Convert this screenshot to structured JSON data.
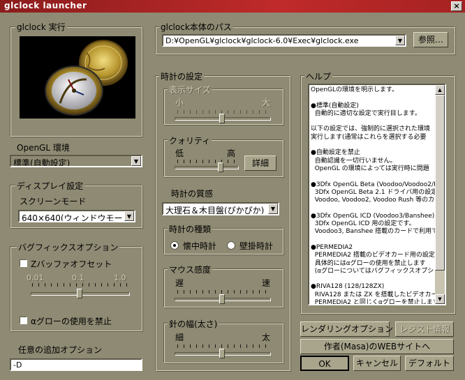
{
  "window": {
    "title": "glclock launcher",
    "close_glyph": "×"
  },
  "run": {
    "label": "glclock 実行"
  },
  "opengl": {
    "label": "OpenGL 環境",
    "value": "標準(自動設定)"
  },
  "display": {
    "label": "ディスプレイ設定",
    "mode_label": "スクリーンモード",
    "mode_value": "640×640(ウィンドウモード)"
  },
  "graphics": {
    "label": "バグフィックスオプション",
    "zbuffer_label": "Zバッファオフセット",
    "zbuffer_checked": false,
    "ticks": [
      "0.01",
      "0.1",
      "1.0"
    ],
    "zbuffer_slider_value": 0.5,
    "alpha_glow_label": "αグローの使用を禁止",
    "alpha_glow_checked": false
  },
  "extra": {
    "label": "任意の追加オプション",
    "value": "-D"
  },
  "path": {
    "label": "glclock本体のパス",
    "value": "D:¥OpenGL¥glclock¥glclock-6.0¥Exec¥glclock.exe",
    "browse_label": "参照…"
  },
  "clock_settings": {
    "label": "時計の設定",
    "display_size": {
      "label": "表示サイズ",
      "min": "小",
      "max": "大",
      "value": 0.5,
      "enabled": false
    },
    "quality": {
      "label": "クォリティ",
      "min": "低",
      "max": "高",
      "value": 0.75,
      "detail_label": "詳細"
    },
    "material": {
      "label": "時計の質感",
      "value": "大理石＆木目盤(ぴかぴか)"
    },
    "clock_type": {
      "label": "時計の種類",
      "options": [
        "懐中時計",
        "壁掛時計"
      ],
      "selected": "懐中時計"
    },
    "mouse": {
      "label": "マウス感度",
      "min": "遅",
      "max": "速",
      "value": 0.5
    },
    "hand_width": {
      "label": "針の幅(太さ)",
      "min": "細",
      "max": "太",
      "value": 0.5
    }
  },
  "help": {
    "label": "ヘルプ",
    "text": "OpenGLの環境を明示します。\n\n●標準(自動設定)\n  自動的に適切な設定で実行目します。\n\n以下の設定では、強制的に選択された環境\n実行します(通常はこれらを選択する必要\n\n●自動設定を禁止\n  自動認識を一切行いません。\n  OpenGL の環境によっては実行時に問題\n\n●3Dfx OpenGL Beta (Voodoo/Voodoo2/R\n  3Dfx OpenGL Beta 2.1 ドライバ用の設定\n  Voodoo, Voodoo2, Voodoo Rush 等のカー\n\n●3Dfx OpenGL ICD (Voodoo3/Banshee)\n  3Dfx OpenGL ICD 用の設定です。\n  Voodoo3, Banshee 搭載のカードで利用で\n\n●PERMEDIA2\n  PERMEDIA2 搭載のビデオカード用の設定\n  具体的にはαグローの使用を禁止します\n  (αグローについてはバグフィックスオプシ\n\n●RIVA128 (128/128ZX)\n  RIVA128 または ZX を搭載したビデオカー\n  PERMEDIA2 と同じくαグローを禁止します"
  },
  "buttons": {
    "rendering": "レンダリングオプション",
    "registry": "レジスト情報",
    "website": "作者(Masa)のWEBサイトへ",
    "ok": "OK",
    "cancel": "キャンセル",
    "default": "デフォルト"
  }
}
